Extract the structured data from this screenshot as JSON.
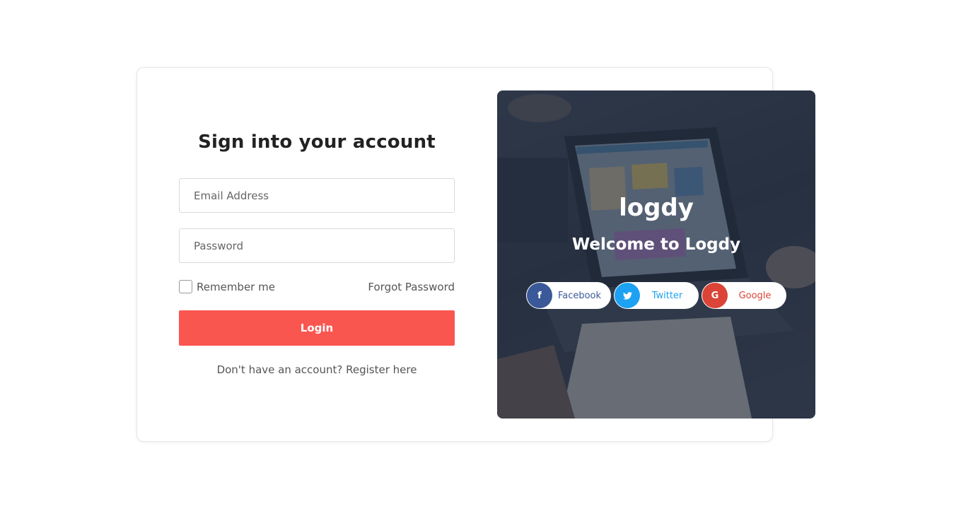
{
  "form": {
    "title": "Sign into your account",
    "email_placeholder": "Email Address",
    "password_placeholder": "Password",
    "remember_label": "Remember me",
    "remember_checked": false,
    "forgot_label": "Forgot Password",
    "login_label": "Login",
    "register_prompt": "Don't have an account? ",
    "register_link": "Register here"
  },
  "hero": {
    "brand": "logdy",
    "welcome": "Welcome to Logdy",
    "social": [
      {
        "label": "Facebook",
        "icon": "facebook-icon",
        "color": "#3b5998"
      },
      {
        "label": "Twitter",
        "icon": "twitter-icon",
        "color": "#1da1f2"
      },
      {
        "label": "Google",
        "icon": "google-icon",
        "color": "#db4437"
      }
    ]
  },
  "colors": {
    "accent": "#fa5650",
    "hero_overlay": "#242d3e"
  }
}
